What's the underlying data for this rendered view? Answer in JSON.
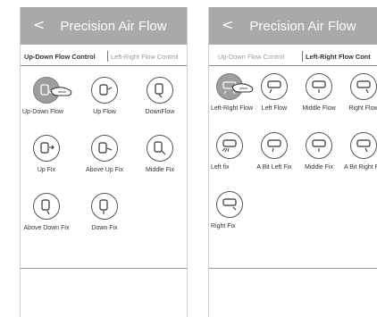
{
  "left_screen": {
    "back": "<",
    "title": "Precision Air Flow",
    "tabs": [
      {
        "label": "Up-Down Flow Control"
      },
      {
        "label": "Left-Right Flow Control"
      }
    ],
    "items": [
      {
        "label": "Up-Down Flow",
        "icon": "up-down-flow-icon"
      },
      {
        "label": "Up Flow",
        "icon": "up-flow-icon"
      },
      {
        "label": "DownFlow",
        "icon": "down-flow-icon"
      },
      {
        "label": "Up Fix",
        "icon": "up-fix-icon"
      },
      {
        "label": "Above Up Fix",
        "icon": "above-up-fix-icon"
      },
      {
        "label": "Middle Fix",
        "icon": "middle-fix-icon"
      },
      {
        "label": "Above Down Fix",
        "icon": "above-down-fix-icon"
      },
      {
        "label": "Down Fix",
        "icon": "down-fix-icon"
      }
    ]
  },
  "right_screen": {
    "back": "<",
    "title": "Precision Air Flow",
    "tabs": [
      {
        "label": "Up-Down Flow Control"
      },
      {
        "label": "Left-Right Flow Cont"
      }
    ],
    "items": [
      {
        "label": "Left-Right Flow",
        "icon": "left-right-flow-icon"
      },
      {
        "label": "Left Flow",
        "icon": "left-flow-icon"
      },
      {
        "label": "Middle Flow",
        "icon": "middle-flow-icon"
      },
      {
        "label": "Right Flow",
        "icon": "right-flow-icon"
      },
      {
        "label": "Left fix",
        "icon": "left-fix-icon"
      },
      {
        "label": "A Bit Left Fix",
        "icon": "a-bit-left-fix-icon"
      },
      {
        "label": "Middle Fix",
        "icon": "middle-fix-icon"
      },
      {
        "label": "A Bit Right Fix",
        "icon": "a-bit-right-fix-icon"
      },
      {
        "label": "Right Fix",
        "icon": "right-fix-icon"
      }
    ]
  }
}
